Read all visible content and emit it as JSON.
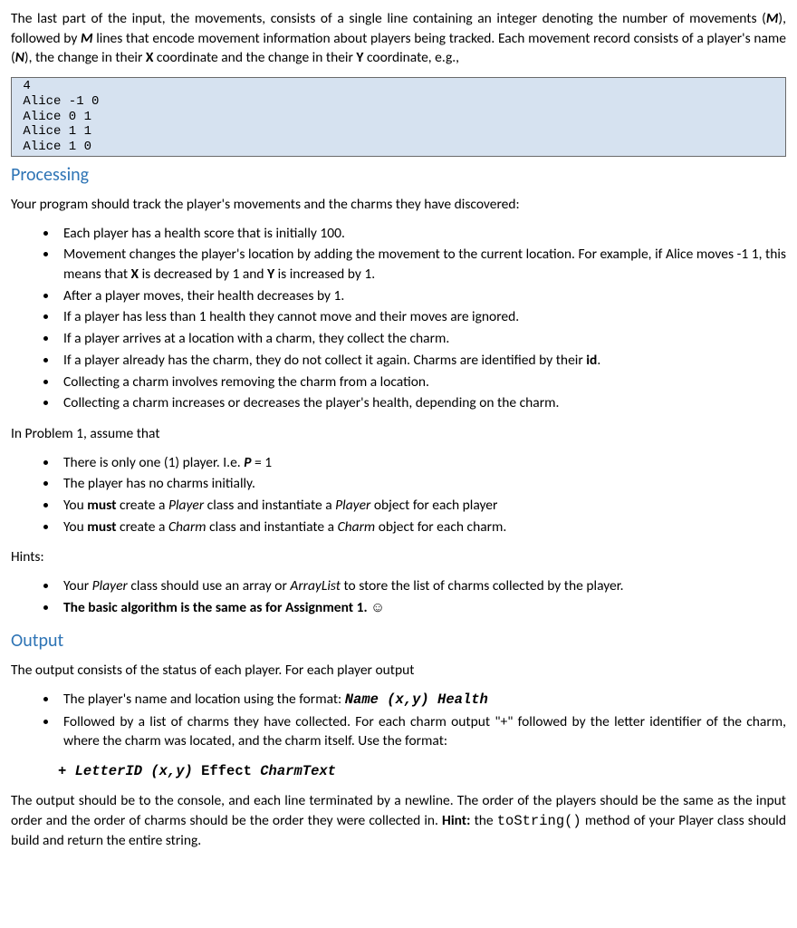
{
  "intro": {
    "p1_a": "The last part of the input, the movements, consists of a single line containing an integer denoting the number of movements (",
    "p1_b": "), followed by ",
    "p1_c": " lines that encode movement information about players being tracked.  Each movement record consists of a player's name (",
    "p1_d": "), the change in their ",
    "p1_e": " coordinate and the change in their ",
    "p1_f": " coordinate, e.g.,",
    "M": "M",
    "N": "N",
    "X": "X",
    "Y": "Y"
  },
  "code1": " 4\n Alice -1 0\n Alice 0 1\n Alice 1 1\n Alice 1 0",
  "processing": {
    "heading": "Processing",
    "p1": "Your program should track the player's movements and the charms they have discovered:",
    "b1": "Each player has a health score that is initially 100.",
    "b2_a": "Movement changes the player's location by adding the movement to the current location.  For example, if Alice moves -1 1, this means that ",
    "b2_b": " is decreased by 1 and ",
    "b2_c": " is increased by 1.",
    "b2_X": "X",
    "b2_Y": "Y",
    "b3": "After a player moves, their health decreases by 1.",
    "b4": "If a player has less than 1 health they cannot move and their moves are ignored.",
    "b5": "If a player arrives at a location with a charm, they collect the charm.",
    "b6_a": "If a player already has the charm, they do not collect it again.  Charms are identified by their ",
    "b6_b": ".",
    "b6_id": "id",
    "b7": "Collecting a charm involves removing the charm from a location.",
    "b8": "Collecting a charm increases or decreases the player's health, depending on the charm.",
    "p2": "In Problem 1, assume that",
    "c1_a": "There is only one (1) player.  I.e. ",
    "c1_b": " = 1",
    "c1_P": "P",
    "c2": "The player has no charms initially.",
    "c3_a": "You ",
    "c3_b": " create a ",
    "c3_c": " class and instantiate a ",
    "c3_d": " object for each player",
    "c3_must": "must",
    "c3_player_i": "Player",
    "c4_a": "You ",
    "c4_b": " create a ",
    "c4_c": " class and instantiate a ",
    "c4_d": " object for each charm.",
    "c4_must": "must",
    "c4_charm_i": "Charm",
    "hints": "Hints:",
    "h1_a": "Your ",
    "h1_b": " class should use an array or ",
    "h1_c": " to store the list of charms collected by the player.",
    "h1_player": "Player",
    "h1_arraylist": "ArrayList",
    "h2_a": "The basic algorithm is the same as for Assignment 1. ",
    "h2_smile": "☺"
  },
  "output": {
    "heading": "Output",
    "p1": "The output consists of the status of each player.  For each player output",
    "b1_a": "The player's name and location using the format: ",
    "b1_fmt": "Name  (x,y)  Health",
    "b2": "Followed by a list of charms they have collected.  For each charm output \"+\" followed by the letter identifier of the charm, where the charm was located, and the charm itself.  Use the format:",
    "fmt_plus": "+ LetterID (x,y) ",
    "fmt_effect": "Effect",
    "fmt_charm": " CharmText",
    "p2_a": "The output should be to the console, and each line terminated by a newline. The order of the players should be the same as the input order and the order of charms should be the order they were collected in.  ",
    "p2_hint": "Hint:",
    "p2_b": " the ",
    "p2_tostring": "toString()",
    "p2_c": " method of your Player class should build and return the entire string."
  }
}
